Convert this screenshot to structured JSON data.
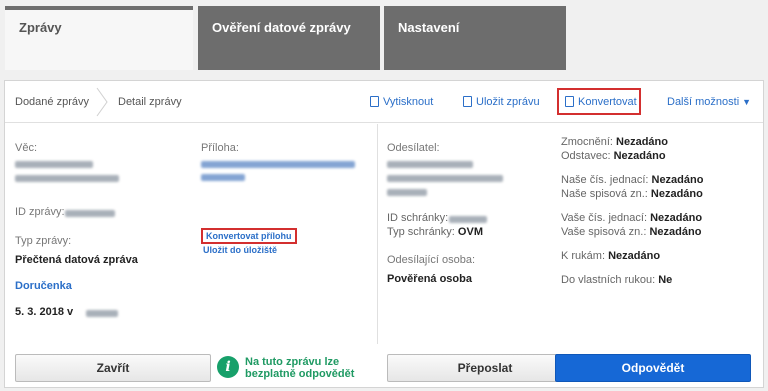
{
  "tabs": [
    {
      "label": "Zprávy"
    },
    {
      "label": "Ověření datové zprávy"
    },
    {
      "label": "Nastavení"
    }
  ],
  "breadcrumb": {
    "items": [
      "Dodané zprávy",
      "Detail zprávy"
    ]
  },
  "toolbar": {
    "print_label": "Vytisknout",
    "save_label": "Uložit zprávu",
    "convert_label": "Konvertovat",
    "more_label": "Další možnosti"
  },
  "left": {
    "subject_label": "Věc:",
    "message_id_label": "ID zprávy:",
    "message_type_label": "Typ zprávy:",
    "message_type_value": "Přečtená datová zpráva",
    "receipt_label": "Doručenka",
    "date_value": "5. 3. 2018 v",
    "attachment_label": "Příloha:",
    "convert_attachment_label": "Konvertovat přílohu",
    "save_to_storage_label": "Uložit do úložiště"
  },
  "right": {
    "sender_label": "Odesílatel:",
    "box_id_label": "ID schránky:",
    "box_type_label": "Typ schránky:",
    "box_type_value": "OVM",
    "sending_person_label": "Odesílající osoba:",
    "sending_person_value": "Pověřená osoba",
    "authorization_label": "Zmocnění:",
    "authorization_value": "Nezadáno",
    "paragraph_label": "Odstavec:",
    "paragraph_value": "Nezadáno",
    "our_ref_label": "Naše čís. jednací:",
    "our_ref_value": "Nezadáno",
    "our_file_label": "Naše spisová zn.:",
    "our_file_value": "Nezadáno",
    "your_ref_label": "Vaše čís. jednací:",
    "your_ref_value": "Nezadáno",
    "your_file_label": "Vaše spisová zn.:",
    "your_file_value": "Nezadáno",
    "attention_label": "K rukám:",
    "attention_value": "Nezadáno",
    "personal_label": "Do vlastních rukou:",
    "personal_value": "Ne"
  },
  "footer": {
    "close_label": "Zavřít",
    "info_line1": "Na tuto zprávu lze",
    "info_line2": "bezplatně odpovědět",
    "forward_label": "Přeposlat",
    "reply_label": "Odpovědět"
  }
}
